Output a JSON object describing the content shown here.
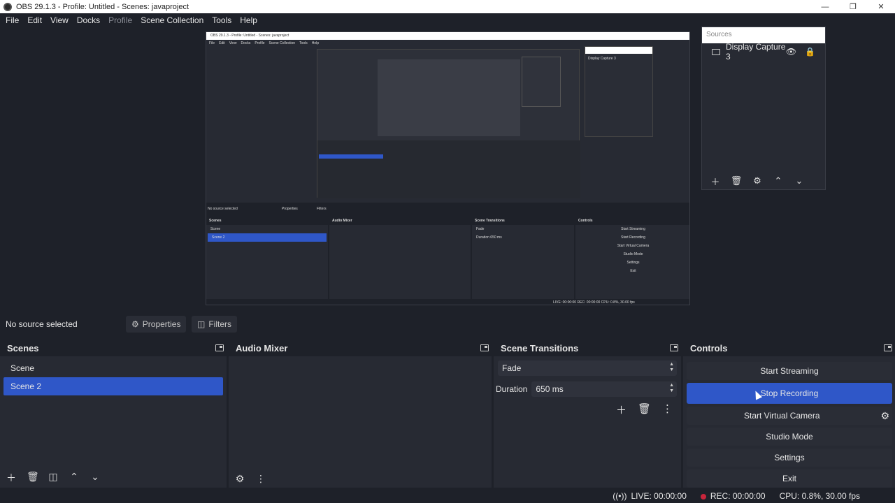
{
  "window": {
    "title": "OBS 29.1.3 - Profile: Untitled - Scenes: javaproject",
    "minimize": "—",
    "maximize": "❐",
    "close": "✕"
  },
  "menu": [
    "File",
    "Edit",
    "View",
    "Docks",
    "Profile",
    "Scene Collection",
    "Tools",
    "Help"
  ],
  "sources": {
    "header": "Sources",
    "items": [
      {
        "name": "Display Capture 3"
      }
    ]
  },
  "source_bar": {
    "no_selection": "No source selected",
    "properties": "Properties",
    "filters": "Filters"
  },
  "scenes": {
    "title": "Scenes",
    "items": [
      "Scene",
      "Scene 2"
    ],
    "selected_index": 1
  },
  "audio_mixer": {
    "title": "Audio Mixer"
  },
  "transitions": {
    "title": "Scene Transitions",
    "type": "Fade",
    "duration_label": "Duration",
    "duration_value": "650 ms"
  },
  "controls": {
    "title": "Controls",
    "start_streaming": "Start Streaming",
    "stop_recording": "Stop Recording",
    "start_virtual_camera": "Start Virtual Camera",
    "studio_mode": "Studio Mode",
    "settings": "Settings",
    "exit": "Exit"
  },
  "status": {
    "live": "LIVE: 00:00:00",
    "rec": "REC: 00:00:00",
    "cpu": "CPU: 0.8%, 30.00 fps"
  },
  "preview_capture": {
    "title": "OBS 29.1.3 - Profile: Untitled - Scenes: javaproject",
    "menu": [
      "File",
      "Edit",
      "View",
      "Docks",
      "Profile",
      "Scene Collection",
      "Tools",
      "Help"
    ],
    "source_name": "Display Capture 3",
    "no_selection": "No source selected",
    "properties": "Properties",
    "filters": "Filters",
    "scenes_title": "Scenes",
    "scene_items": [
      "Scene",
      "Scene 2"
    ],
    "mixer_title": "Audio Mixer",
    "transitions_title": "Scene Transitions",
    "transition_type": "Fade",
    "duration_label": "Duration",
    "duration_value": "650 ms",
    "controls_title": "Controls",
    "controls": [
      "Start Streaming",
      "Start Recording",
      "Start Virtual Camera",
      "Studio Mode",
      "Settings",
      "Exit"
    ],
    "status": "LIVE: 00:00:00   REC: 00:00:00   CPU: 0.8%, 30.00 fps"
  }
}
